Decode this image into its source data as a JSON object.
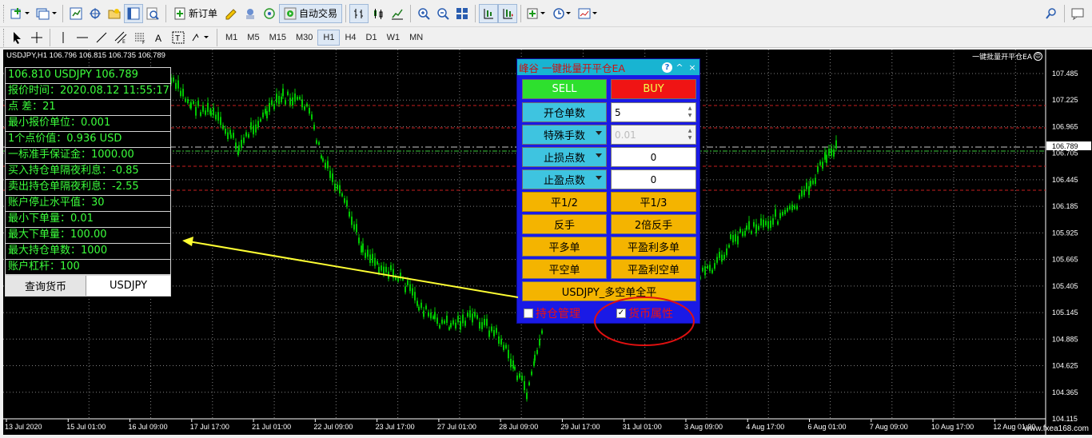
{
  "toolbar1": {
    "new_order_label": "新订单",
    "auto_trade_label": "自动交易"
  },
  "toolbar2": {
    "timeframes": [
      "M1",
      "M5",
      "M15",
      "M30",
      "H1",
      "H4",
      "D1",
      "W1",
      "MN"
    ],
    "active_timeframe": "H1"
  },
  "chart": {
    "title": "USDJPY,H1  106.796 106.815 106.735 106.789",
    "price_labels": [
      "107.485",
      "107.225",
      "106.965",
      "106.705",
      "106.445",
      "106.185",
      "105.925",
      "105.665",
      "105.405",
      "105.145",
      "104.885",
      "104.625",
      "104.365",
      "104.115"
    ],
    "current_price": "106.789",
    "time_labels": [
      "13 Jul 2020",
      "15 Jul 01:00",
      "16 Jul 09:00",
      "17 Jul 17:00",
      "21 Jul 01:00",
      "22 Jul 09:00",
      "23 Jul 17:00",
      "27 Jul 01:00",
      "28 Jul 09:00",
      "29 Jul 17:00",
      "31 Jul 01:00",
      "3 Aug 09:00",
      "4 Aug 17:00",
      "6 Aug 01:00",
      "7 Aug 09:00",
      "10 Aug 17:00",
      "12 Aug 01:00"
    ],
    "ea_tag": "一键批量开平仓EA",
    "watermark": "www.fxea168.com",
    "colors": {
      "background": "#000000",
      "candles": "#00c800",
      "grid": "#808080",
      "stop_lines": "#c81e1e",
      "price_line": "#c8c8c8"
    }
  },
  "info_panel": {
    "rows": [
      "106.810    USDJPY    106.789",
      "报价时间：2020.08.12 11:55:17",
      "点      差：21",
      "最小报价单位：0.001",
      "1个点价值：0.936 USD",
      "一标准手保证金：1000.00",
      "买入持仓单隔夜利息：-0.85",
      "卖出持仓单隔夜利息：-2.55",
      "账户停止水平值：30",
      "最小下单量：0.01",
      "最大下单量：100.00",
      "最大持仓单数：1000",
      "账户杠杆：100"
    ],
    "query_button": "查询货币",
    "query_value": "USDJPY"
  },
  "ea_panel": {
    "title": "峰谷 一键批量开平仓EA",
    "sell": "SELL",
    "buy": "BUY",
    "open_lots_label": "开仓单数",
    "open_lots_value": "5",
    "special_lots_label": "特殊手数",
    "special_lots_value": "0.01",
    "stop_loss_label": "止损点数",
    "stop_loss_value": "0",
    "take_profit_label": "止盈点数",
    "take_profit_value": "0",
    "close_half": "平1/2",
    "close_third": "平1/3",
    "reverse": "反手",
    "double_reverse": "2倍反手",
    "close_long": "平多单",
    "close_profit_long": "平盈利多单",
    "close_short": "平空单",
    "close_profit_short": "平盈利空单",
    "close_all": "USDJPY_多空单全平",
    "position_mgmt": "持仓管理",
    "currency_props": "货币属性"
  }
}
